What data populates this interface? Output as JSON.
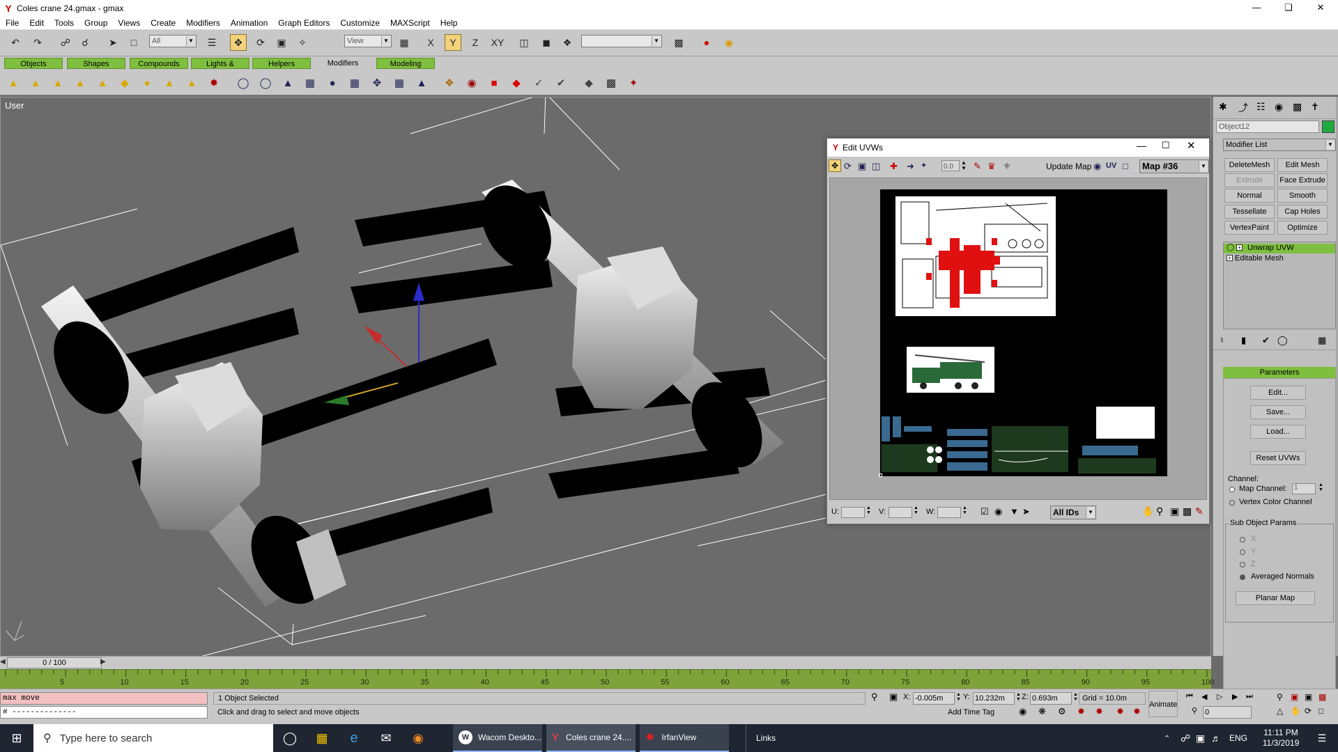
{
  "window": {
    "title": "Coles crane 24.gmax - gmax",
    "app_icon": "gmax-logo-icon"
  },
  "menu": [
    "File",
    "Edit",
    "Tools",
    "Group",
    "Views",
    "Create",
    "Modifiers",
    "Animation",
    "Graph Editors",
    "Customize",
    "MAXScript",
    "Help"
  ],
  "toolbar": {
    "selection_filter": "All",
    "coord_system": "View",
    "named_selection": ""
  },
  "tabs": [
    "Objects",
    "Shapes",
    "Compounds",
    "Lights & Cameras",
    "Helpers",
    "Modifiers",
    "Modeling"
  ],
  "active_tab": "Modifiers",
  "viewport": {
    "label": "User"
  },
  "command_panel": {
    "object_name": "Object12",
    "object_color": "#1faa3f",
    "modifier_list": "Modifier List",
    "buttons": [
      "DeleteMesh",
      "Edit Mesh",
      "Extrude",
      "Face Extrude",
      "Normal",
      "Smooth",
      "Tessellate",
      "Cap Holes",
      "VertexPaint",
      "Optimize"
    ],
    "stack": [
      "Unwrap UVW",
      "Editable Mesh"
    ],
    "parameters_title": "Parameters",
    "edit_btn": "Edit...",
    "save_btn": "Save...",
    "load_btn": "Load...",
    "reset_btn": "Reset UVWs",
    "channel_label": "Channel:",
    "map_channel_label": "Map Channel:",
    "map_channel_value": "1",
    "vertex_color_label": "Vertex Color Channel",
    "subobj_title": "Sub Object Params",
    "axis_x": "X",
    "axis_y": "Y",
    "axis_z": "Z",
    "averaged_normals": "Averaged Normals",
    "planar_map_btn": "Planar Map"
  },
  "uvw_editor": {
    "title": "Edit UVWs",
    "spinner_value": "0.0",
    "update_map": "Update Map",
    "uv_label": "UV",
    "map_select": "Map #36",
    "u_label": "U:",
    "v_label": "V:",
    "w_label": "W:",
    "ids_select": "All IDs"
  },
  "timeline": {
    "frame_display": "0 / 100",
    "ticks": [
      "5",
      "10",
      "15",
      "20",
      "25",
      "30",
      "35",
      "40",
      "45",
      "50",
      "55",
      "60",
      "65",
      "70",
      "75",
      "80",
      "85",
      "90",
      "95",
      "100"
    ]
  },
  "status": {
    "maxscript_line1": "max move",
    "maxscript_line2": "# --------------",
    "selection_text": "1 Object Selected",
    "prompt_text": "Click and drag to select and move objects",
    "x_value": "-0.005m",
    "y_value": "10.232m",
    "z_value": "0.693m",
    "grid": "Grid = 10.0m",
    "add_time_tag": "Add Time Tag",
    "animate": "Animate",
    "frame_field": "0",
    "x_label": "X:",
    "y_label": "Y:",
    "z_label": "Z:"
  },
  "taskbar": {
    "search_placeholder": "Type here to search",
    "apps": [
      "Wacom Deskto...",
      "Coles crane 24....",
      "IrfanView"
    ],
    "links": "Links",
    "lang": "ENG",
    "time": "11:11 PM",
    "date": "11/3/2019"
  }
}
